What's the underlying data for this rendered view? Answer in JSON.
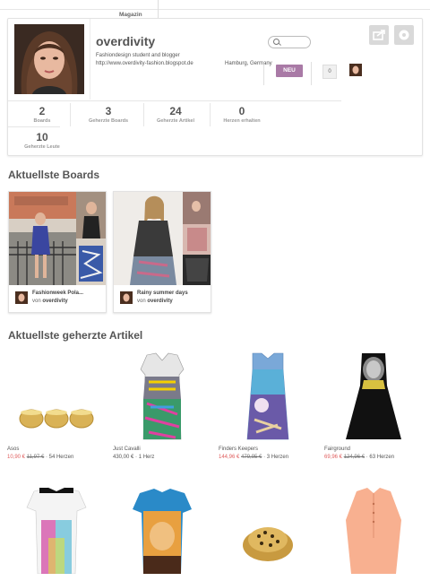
{
  "topnav": {
    "tab_label": "Magazin"
  },
  "profile": {
    "name": "overdivity",
    "bio": "Fashiondesign student and blogger",
    "url": "http://www.overdivity-fashion.blogspot.de",
    "location": "Hamburg, Germany",
    "new_button": "NEU",
    "count_badge": "0",
    "stats": [
      {
        "value": "2",
        "label": "Boards"
      },
      {
        "value": "3",
        "label": "Geherzte Boards"
      },
      {
        "value": "24",
        "label": "Geherzte Artikel"
      },
      {
        "value": "0",
        "label": "Herzen erhalten"
      },
      {
        "value": "10",
        "label": "Geherzte Leute"
      }
    ]
  },
  "boards_section": {
    "title": "Aktuellste Boards",
    "boards": [
      {
        "title": "Fashionweek Pola...",
        "by_prefix": "von",
        "by_user": "overdivity"
      },
      {
        "title": "Rainy summer days",
        "by_prefix": "von",
        "by_user": "overdivity"
      }
    ]
  },
  "articles_section": {
    "title": "Aktuellste geherzte Artikel",
    "items": [
      {
        "brand": "Asos",
        "sale_price": "10,90 €",
        "old_price": "11,97 €",
        "hearts": "54 Herzen"
      },
      {
        "brand": "Just Cavalli",
        "price": "430,00 €",
        "hearts": "1 Herz"
      },
      {
        "brand": "Finders Keepers",
        "sale_price": "144,96 €",
        "old_price": "479,95 €",
        "hearts": "3 Herzen"
      },
      {
        "brand": "Fairground",
        "sale_price": "69,96 €",
        "old_price": "124,96 €",
        "hearts": "63 Herzen"
      }
    ]
  },
  "colors": {
    "accent": "#a97aa6",
    "sale": "#e06060"
  }
}
